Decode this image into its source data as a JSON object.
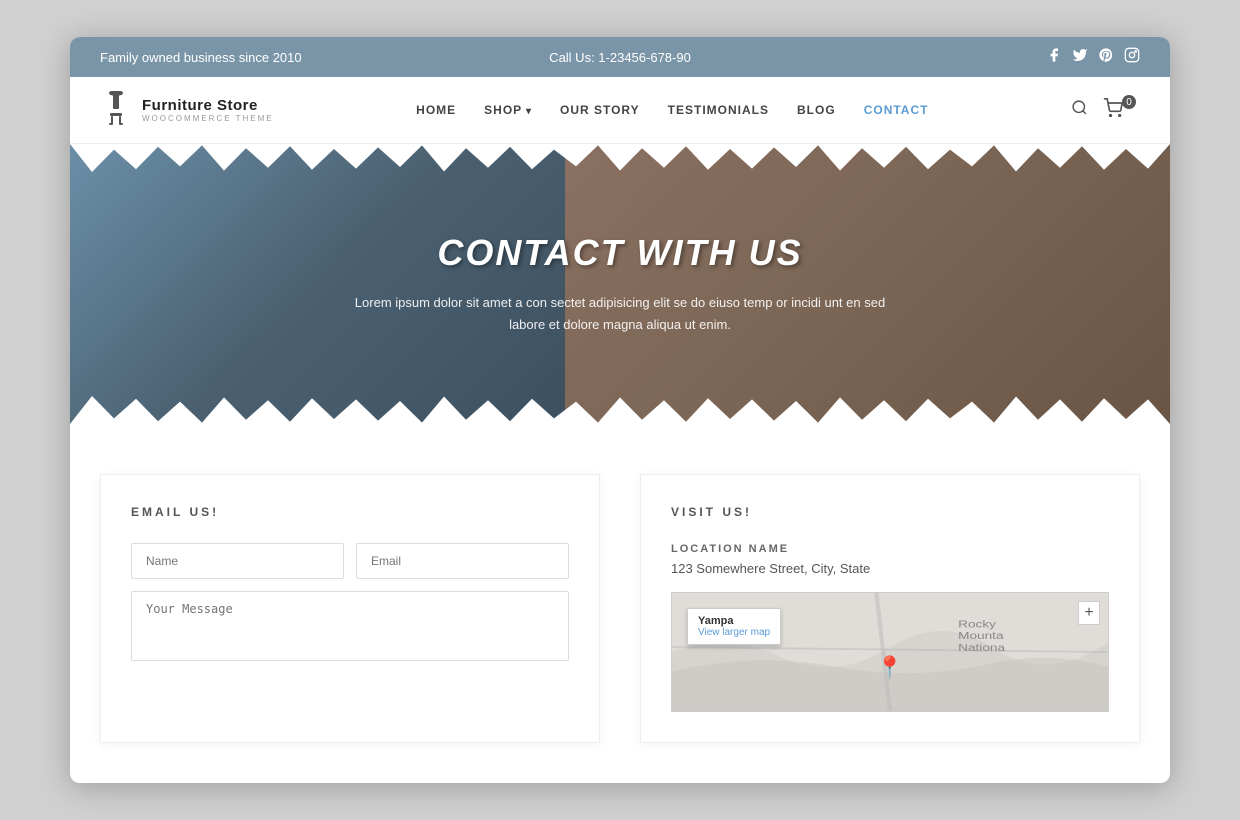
{
  "topbar": {
    "left_text": "Family owned business since 2010",
    "center_text": "Call Us: 1-23456-678-90",
    "social_icons": [
      "f",
      "t",
      "p",
      "i"
    ]
  },
  "nav": {
    "logo_title": "Furniture Store",
    "logo_subtitle": "WOOCOMMERCE THEME",
    "links": [
      {
        "label": "HOME",
        "active": false
      },
      {
        "label": "SHOP",
        "active": false,
        "has_dropdown": true
      },
      {
        "label": "OUR STORY",
        "active": false
      },
      {
        "label": "TESTIMONIALS",
        "active": false
      },
      {
        "label": "BLOG",
        "active": false
      },
      {
        "label": "CONTACT",
        "active": true
      }
    ],
    "cart_count": "0"
  },
  "hero": {
    "title": "CONTACT WITH US",
    "subtitle": "Lorem ipsum dolor sit amet a con sectet adipisicing elit se do eiuso temp or incidi unt en sed labore et dolore magna aliqua ut enim."
  },
  "email_section": {
    "heading": "EMAIL US!",
    "name_placeholder": "Name",
    "email_placeholder": "Email",
    "message_placeholder": "Your Message"
  },
  "visit_section": {
    "heading": "VISIT US!",
    "location_label": "LOCATION NAME",
    "address": "123 Somewhere Street, City, State",
    "map_city": "Yampa",
    "map_link": "View larger map",
    "zoom_icon": "+"
  }
}
